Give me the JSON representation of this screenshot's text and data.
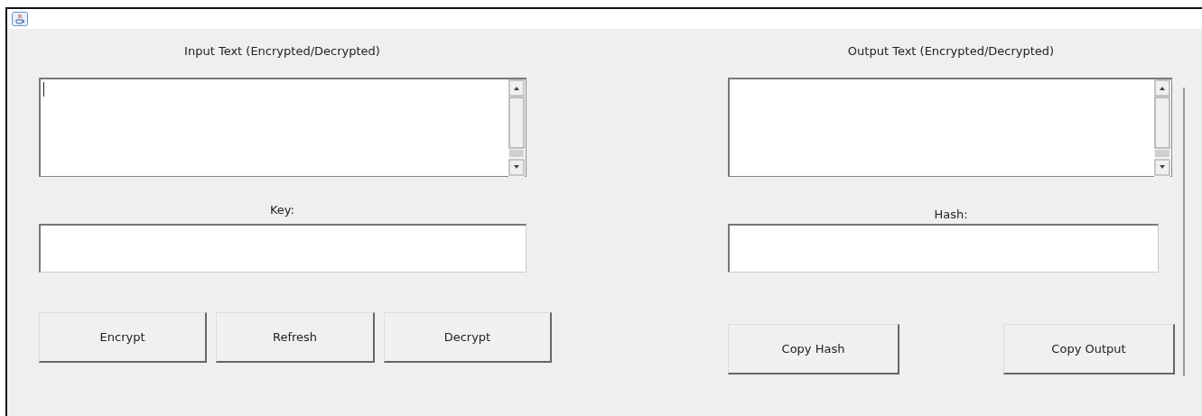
{
  "left_panel": {
    "text_label": "Input Text (Encrypted/Decrypted)",
    "text_area": {
      "focused": true
    },
    "field_label": "Key:",
    "buttons": [
      "Encrypt",
      "Refresh",
      "Decrypt"
    ]
  },
  "right_panel": {
    "text_label": "Output Text (Encrypted/Decrypted)",
    "text_area": {
      "focused": false
    },
    "field_label": "Hash:",
    "buttons": [
      "Copy Hash",
      "Copy Output"
    ]
  }
}
